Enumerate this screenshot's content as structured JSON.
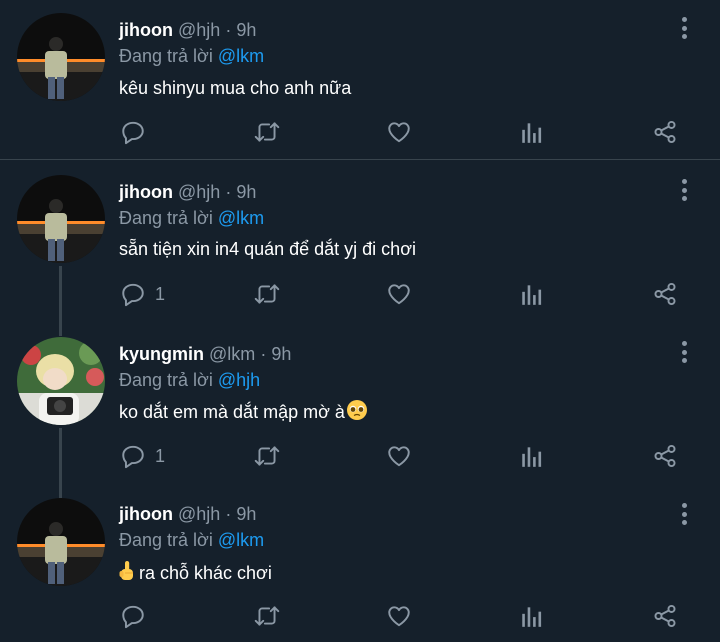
{
  "tweets": [
    {
      "name": "jihoon",
      "handle": "@hjh",
      "dot": "·",
      "time": "9h",
      "reply_prefix": "Đang trả lời",
      "reply_to": "@lkm",
      "text": "kêu shinyu mua cho anh nữa",
      "reply_count": "",
      "avatar": "avatar-jihoon"
    },
    {
      "name": "jihoon",
      "handle": "@hjh",
      "dot": "·",
      "time": "9h",
      "reply_prefix": "Đang trả lời",
      "reply_to": "@lkm",
      "text": "sẵn tiện xin in4 quán để dắt yj đi chơi",
      "reply_count": "1",
      "avatar": "avatar-jihoon"
    },
    {
      "name": "kyungmin",
      "handle": "@lkm",
      "dot": "·",
      "time": "9h",
      "reply_prefix": "Đang trả lời",
      "reply_to": "@hjh",
      "text": "ko dắt em mà dắt mập mờ à",
      "text_emoji": "pleading-face-emoji",
      "reply_count": "1",
      "avatar": "avatar-kyungmin"
    },
    {
      "name": "jihoon",
      "handle": "@hjh",
      "dot": "·",
      "time": "9h",
      "reply_prefix": "Đang trả lời",
      "reply_to": "@lkm",
      "text_emoji": "middle-finger-emoji",
      "text": "ra chỗ khác chơi",
      "reply_count": "",
      "avatar": "avatar-jihoon"
    }
  ],
  "icons": [
    "reply-icon",
    "retweet-icon",
    "like-icon",
    "analytics-icon",
    "share-icon",
    "more-icon"
  ],
  "colors": {
    "background": "#15202b",
    "secondary_text": "#8b98a5",
    "mention": "#1d9bf0",
    "divider": "#38444d"
  }
}
